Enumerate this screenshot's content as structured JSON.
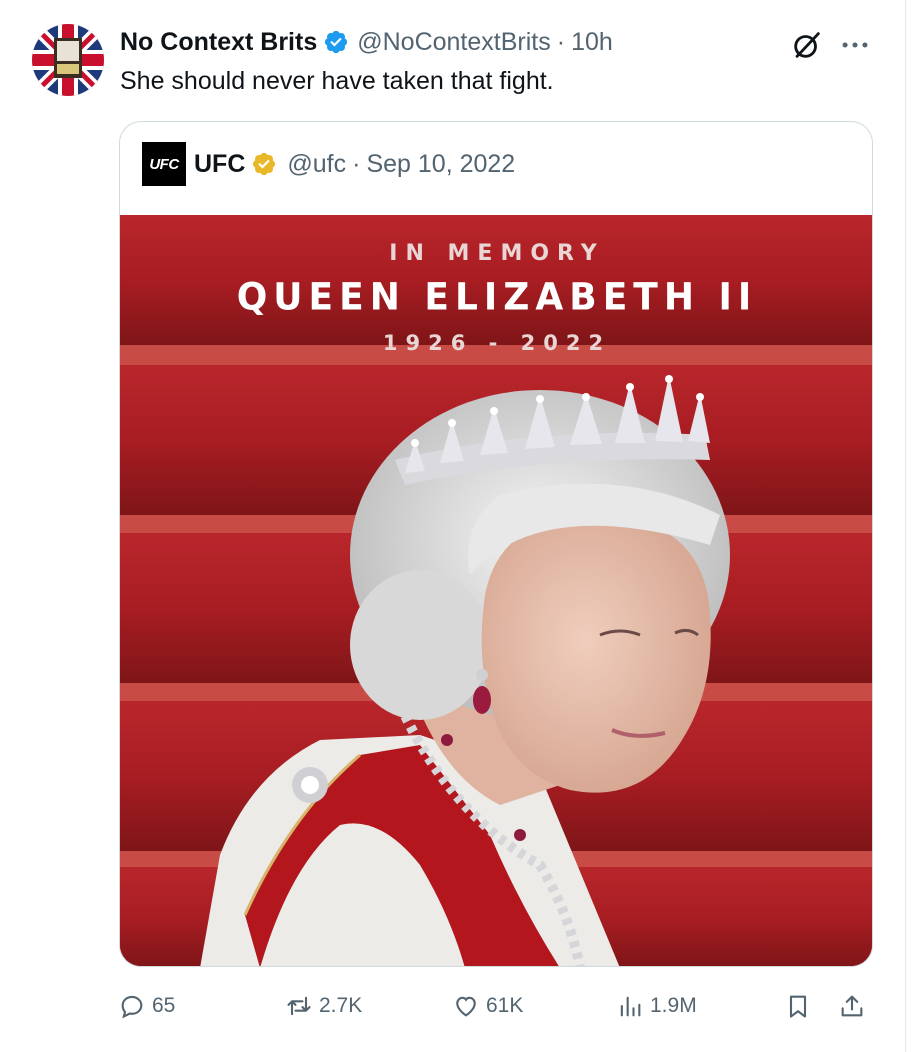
{
  "tweet": {
    "display_name": "No Context Brits",
    "handle": "@NoContextBrits",
    "separator": "·",
    "time": "10h",
    "text": "She should never have taken that fight."
  },
  "quoted": {
    "logo_text": "UFC",
    "display_name": "UFC",
    "handle": "@ufc",
    "separator": "·",
    "date": "Sep 10, 2022",
    "image": {
      "line1": "IN MEMORY",
      "line2": "QUEEN ELIZABETH II",
      "line3": "1926 - 2022"
    }
  },
  "actions": {
    "replies": "65",
    "reposts": "2.7K",
    "likes": "61K",
    "views": "1.9M"
  },
  "colors": {
    "text_primary": "#0f1419",
    "text_secondary": "#536471",
    "verified_blue": "#1d9bf0",
    "verified_gold": "#e8b829",
    "image_red": "#a91f24"
  },
  "icons": [
    "verified-badge-icon",
    "grok-icon",
    "more-icon",
    "reply-icon",
    "repost-icon",
    "like-icon",
    "views-icon",
    "bookmark-icon",
    "share-icon"
  ]
}
